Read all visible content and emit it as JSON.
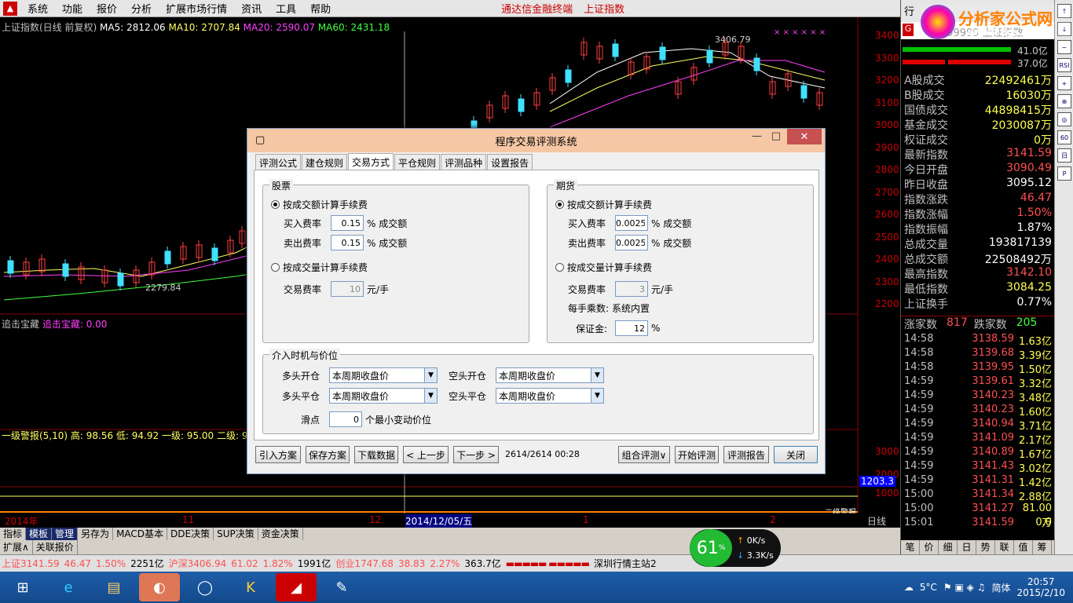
{
  "menubar": {
    "items": [
      "系统",
      "功能",
      "报价",
      "分析",
      "扩展市场行情",
      "资讯",
      "工具",
      "帮助"
    ],
    "hot": [
      "通达信金融终端",
      "上证指数"
    ]
  },
  "chart": {
    "title": "上证指数(日线 前复权)",
    "ma5": "MA5: 2812.06",
    "ma10": "MA10: 2707.84",
    "ma20": "MA20: 2590.07",
    "ma60": "MA60: 2431.18",
    "hi_label": "3406.79",
    "lo_label": "2279.84",
    "yticks": [
      "3400",
      "3300",
      "3200",
      "3100",
      "3000",
      "2900",
      "2800",
      "2700",
      "2600",
      "2500",
      "2400",
      "2300",
      "2200"
    ],
    "ind1": "追击宝藏",
    "ind1b": "追击宝藏: 0.00",
    "ind2": "一级警报(5,10) 高: 98.56  低: 94.92  一级: 95.00  二级: 90.0",
    "vol_ticks": [
      "3000",
      "2000",
      "1000"
    ],
    "vol_val": "1203.3",
    "date_labels": [
      "2014年",
      "11",
      "12",
      "2014/12/05/五",
      "1",
      "2"
    ],
    "period": "日线",
    "alert": "二级警报"
  },
  "tabs1": [
    "指标",
    "模板",
    "管理",
    "另存为",
    "MACD基本",
    "DDE决策",
    "SUP决策",
    "资金决策"
  ],
  "tabs2": [
    "扩展∧",
    "关联报价"
  ],
  "sidebar": {
    "header": "行",
    "code": "999999 上证指数",
    "bar_vals": [
      "41.0亿",
      "37.0亿"
    ],
    "rows": [
      {
        "k": "A股成交",
        "v": "22492461万"
      },
      {
        "k": "B股成交",
        "v": "16030万"
      },
      {
        "k": "国债成交",
        "v": "44898415万"
      },
      {
        "k": "基金成交",
        "v": "2030087万"
      },
      {
        "k": "权证成交",
        "v": "0万"
      },
      {
        "k": "最新指数",
        "v": "3141.59"
      },
      {
        "k": "今日开盘",
        "v": "3090.49"
      },
      {
        "k": "昨日收盘",
        "v": "3095.12"
      },
      {
        "k": "指数涨跌",
        "v": "46.47"
      },
      {
        "k": "指数涨幅",
        "v": "1.50%"
      },
      {
        "k": "指数振幅",
        "v": "1.87%"
      },
      {
        "k": "总成交量",
        "v": "193817139"
      },
      {
        "k": "总成交额",
        "v": "22508492万"
      },
      {
        "k": "最高指数",
        "v": "3142.10"
      },
      {
        "k": "最低指数",
        "v": "3084.25"
      },
      {
        "k": "上证换手",
        "v": "0.77%"
      }
    ],
    "rise": "涨家数",
    "rise_n": "817",
    "fall": "跌家数",
    "fall_n": "205",
    "ticks": [
      [
        "14:58",
        "3138.59",
        "1.63亿"
      ],
      [
        "14:58",
        "3139.68",
        "3.39亿"
      ],
      [
        "14:58",
        "3139.95",
        "1.50亿"
      ],
      [
        "14:59",
        "3139.61",
        "3.32亿"
      ],
      [
        "14:59",
        "3140.23",
        "3.48亿"
      ],
      [
        "14:59",
        "3140.23",
        "1.60亿"
      ],
      [
        "14:59",
        "3140.94",
        "3.71亿"
      ],
      [
        "14:59",
        "3141.09",
        "2.17亿"
      ],
      [
        "14:59",
        "3140.89",
        "1.67亿"
      ],
      [
        "14:59",
        "3141.43",
        "3.02亿"
      ],
      [
        "14:59",
        "3141.31",
        "1.42亿"
      ],
      [
        "15:00",
        "3141.34",
        "2.88亿"
      ],
      [
        "15:00",
        "3141.27",
        "81.00万"
      ],
      [
        "15:01",
        "3141.59",
        "0.0"
      ]
    ],
    "bottom_tabs": [
      "笔",
      "价",
      "细",
      "日",
      "势",
      "联",
      "值",
      "筹"
    ]
  },
  "vtool": [
    "↑",
    "↓",
    "~",
    "RSI",
    "+",
    "⊕",
    "◎",
    "60",
    "日",
    "P"
  ],
  "status": {
    "sh": "上证3141.59",
    "sh_d": "46.47",
    "sh_p": "1.50%",
    "sh_v": "2251亿",
    "sz": "沪深3406.94",
    "sz_d": "61.02",
    "sz_p": "1.82%",
    "sz_v": "1991亿",
    "cy": "创业1747.68",
    "cy_d": "38.83",
    "cy_p": "2.27%",
    "cy_v": "363.7亿",
    "server": "深圳行情主站2"
  },
  "net": {
    "pct": "61",
    "unit": "%",
    "up": "0K/s",
    "down": "3.3K/s"
  },
  "taskbar": {
    "temp": "5°C",
    "ime": "简体",
    "time": "20:57",
    "date": "2015/2/10"
  },
  "watermark": {
    "text": "分析家公式网",
    "url": "www.88gs.com"
  },
  "dialog": {
    "title": "程序交易评测系统",
    "tabs": [
      "评测公式",
      "建仓规则",
      "交易方式",
      "平仓规则",
      "评测品种",
      "设置报告"
    ],
    "stock": {
      "label": "股票",
      "r1": "按成交额计算手续费",
      "buy": "买入费率",
      "buy_v": "0.15",
      "sell": "卖出费率",
      "sell_v": "0.15",
      "unit": "% 成交额",
      "r2": "按成交量计算手续费",
      "fee": "交易费率",
      "fee_v": "10",
      "fee_u": "元/手"
    },
    "futures": {
      "label": "期货",
      "r1": "按成交额计算手续费",
      "buy": "买入费率",
      "buy_v": "0.0025",
      "sell": "卖出费率",
      "sell_v": "0.0025",
      "unit": "% 成交额",
      "r2": "按成交量计算手续费",
      "fee": "交易费率",
      "fee_v": "3",
      "fee_u": "元/手",
      "mult": "每手乘数:",
      "mult_v": "系统内置",
      "margin": "保证金:",
      "margin_v": "12",
      "pct": "%"
    },
    "entry": {
      "label": "介入时机与价位",
      "long_open": "多头开仓",
      "long_close": "多头平仓",
      "short_open": "空头开仓",
      "short_close": "空头平仓",
      "opt": "本周期收盘价",
      "slip": "滑点",
      "slip_v": "0",
      "slip_u": "个最小变动价位"
    },
    "buttons": {
      "import": "引入方案",
      "save": "保存方案",
      "download": "下载数据",
      "prev": "< 上一步",
      "next": "下一步 >",
      "progress": "2614/2614 00:28",
      "combo": "组合评测∨",
      "start": "开始评测",
      "report": "评测报告",
      "close": "关闭"
    }
  }
}
